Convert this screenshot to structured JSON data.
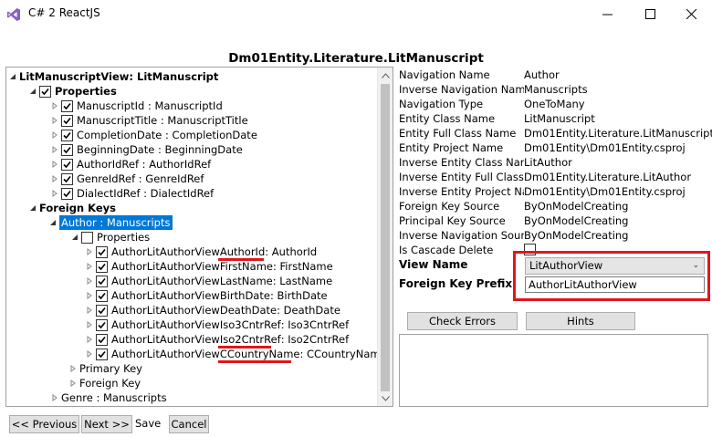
{
  "window": {
    "title": "C# 2 ReactJS",
    "icon": "visual-studio-icon"
  },
  "heading": "Dm01Entity.Literature.LitManuscript",
  "tree": {
    "root": "LitManuscriptView: LitManuscript",
    "properties_label": "Properties",
    "properties": [
      "ManuscriptId : ManuscriptId",
      "ManuscriptTitle : ManuscriptTitle",
      "CompletionDate : CompletionDate",
      "BeginningDate : BeginningDate",
      "AuthorIdRef : AuthorIdRef",
      "GenreIdRef : GenreIdRef",
      "DialectIdRef : DialectIdRef"
    ],
    "foreign_keys_label": "Foreign Keys",
    "selected_node": "Author : Manuscripts",
    "sub_properties_label": "Properties",
    "fk_properties": [
      {
        "prefix": "AuthorLitAuthorView",
        "suffix": "AuthorId",
        "rest": " : AuthorId"
      },
      {
        "prefix": "AuthorLitAuthorView",
        "suffix": "FirstName",
        "rest": " : FirstName"
      },
      {
        "prefix": "AuthorLitAuthorView",
        "suffix": "LastName",
        "rest": " : LastName"
      },
      {
        "prefix": "AuthorLitAuthorView",
        "suffix": "BirthDate",
        "rest": " : BirthDate"
      },
      {
        "prefix": "AuthorLitAuthorView",
        "suffix": "DeathDate",
        "rest": " : DeathDate"
      },
      {
        "prefix": "AuthorLitAuthorView",
        "suffix": "Iso3CntrRef",
        "rest": " : Iso3CntrRef"
      },
      {
        "prefix": "AuthorLitAuthorView",
        "suffix": "Iso2CntrRef",
        "rest": " : Iso2CntrRef"
      },
      {
        "prefix": "AuthorLitAuthorView",
        "suffix": "CCountryName",
        "rest": " : CCountryName"
      }
    ],
    "primary_key_label": "Primary Key",
    "foreign_key_label": "Foreign Key",
    "genre_node": "Genre : Manuscripts"
  },
  "properties_grid": [
    {
      "name": "Navigation Name",
      "value": "Author"
    },
    {
      "name": "Inverse Navigation Name",
      "value": "Manuscripts"
    },
    {
      "name": "Navigation Type",
      "value": "OneToMany"
    },
    {
      "name": "Entity Class Name",
      "value": "LitManuscript"
    },
    {
      "name": "Entity Full Class Name",
      "value": "Dm01Entity.Literature.LitManuscript"
    },
    {
      "name": "Entity Project Name",
      "value": "Dm01Entity\\Dm01Entity.csproj"
    },
    {
      "name": "Inverse Entity Class Name",
      "value": "LitAuthor"
    },
    {
      "name": "Inverse Entity Full Class Name",
      "value": "Dm01Entity.Literature.LitAuthor"
    },
    {
      "name": "Inverse Entity Project Name",
      "value": "Dm01Entity\\Dm01Entity.csproj"
    },
    {
      "name": "Foreign Key Source",
      "value": "ByOnModelCreating"
    },
    {
      "name": "Principal Key Source",
      "value": "ByOnModelCreating"
    },
    {
      "name": "Inverse Navigation Source",
      "value": "ByOnModelCreating"
    },
    {
      "name": "Is Cascade Delete",
      "value": ""
    }
  ],
  "form": {
    "view_name_label": "View Name",
    "view_name_value": "LitAuthorView",
    "fk_prefix_label": "Foreign Key Prefix",
    "fk_prefix_value": "AuthorLitAuthorView"
  },
  "buttons": {
    "check_errors": "Check Errors",
    "hints": "Hints",
    "previous": "<< Previous",
    "next": "Next >>",
    "save": "Save",
    "cancel": "Cancel"
  },
  "colors": {
    "selection": "#0078d7",
    "annotation_red": "#e0161d"
  }
}
